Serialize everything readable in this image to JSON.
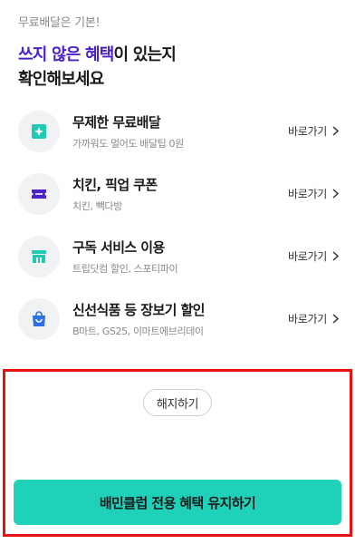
{
  "intro": {
    "subtitle": "무료배달은 기본!",
    "headline_highlight": "쓰지 않은 혜택",
    "headline_rest_line1": "이 있는지",
    "headline_line2": "확인해보세요"
  },
  "benefits": [
    {
      "icon": "star-sparkle-icon",
      "title": "무제한 무료배달",
      "desc": "가까워도 멀어도 배달팁 0원",
      "link": "바로가기"
    },
    {
      "icon": "coupon-ticket-icon",
      "title": "치킨, 픽업 쿠폰",
      "desc": "치킨, 빽다방",
      "link": "바로가기"
    },
    {
      "icon": "store-icon",
      "title": "구독 서비스 이용",
      "desc": "트립닷컴 할인, 스포티파이",
      "link": "바로가기"
    },
    {
      "icon": "shopping-bag-icon",
      "title": "신선식품 등 장보기 할인",
      "desc": "B마트, GS25, 이마트에브리데이",
      "link": "바로가기"
    }
  ],
  "actions": {
    "cancel_label": "해지하기",
    "keep_label": "배민클럽 전용 혜택 유지하기"
  },
  "colors": {
    "accent": "#4b22c9",
    "primary": "#20d1ba",
    "icon": "#1fc9b3",
    "highlight_border": "#e41212"
  }
}
